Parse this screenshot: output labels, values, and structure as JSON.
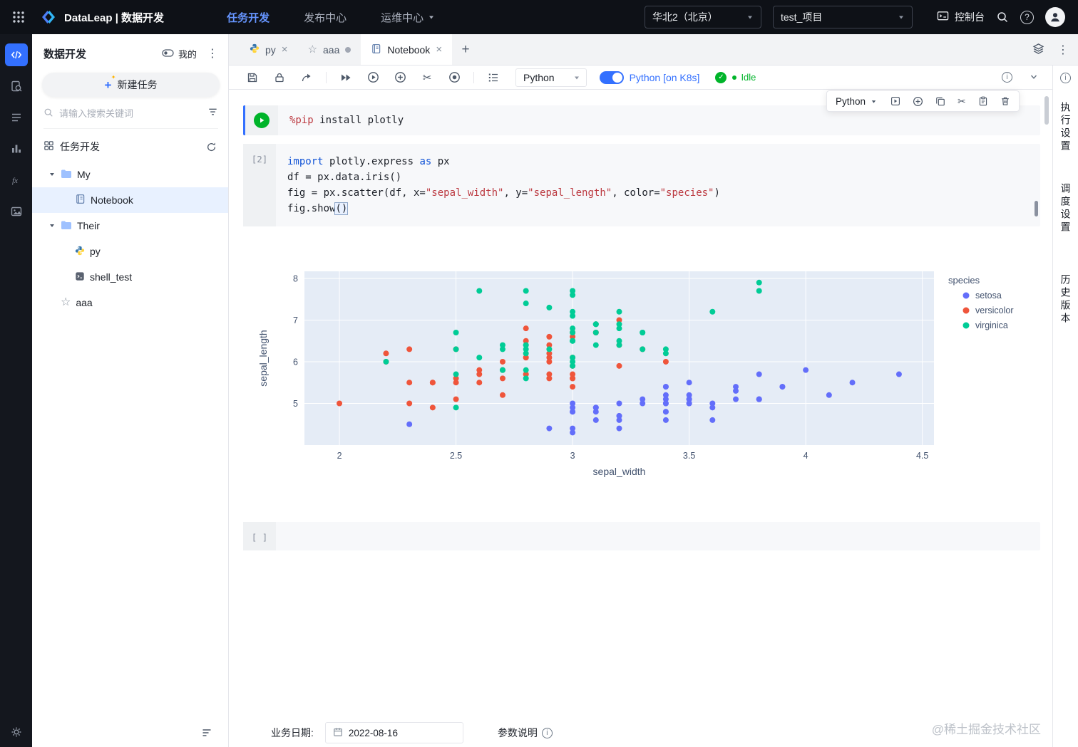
{
  "topbar": {
    "brand": "DataLeap | 数据开发",
    "nav_items": [
      {
        "label": "任务开发",
        "active": true
      },
      {
        "label": "发布中心",
        "active": false
      },
      {
        "label": "运维中心",
        "active": false
      }
    ],
    "region_select": "华北2（北京）",
    "project_select": "test_项目",
    "console_label": "控制台"
  },
  "sidebar": {
    "title": "数据开发",
    "mine_label": "我的",
    "new_task_label": "新建任务",
    "search_placeholder": "请输入搜索关键词",
    "section_label": "任务开发",
    "tree": {
      "folder_my": "My",
      "notebook": "Notebook",
      "folder_their": "Their",
      "py": "py",
      "shell": "shell_test",
      "aaa": "aaa"
    }
  },
  "tabs": {
    "py": "py",
    "aaa": "aaa",
    "notebook": "Notebook"
  },
  "toolbar": {
    "kernel": "Python",
    "k8s_label": "Python [on K8s]",
    "idle_label": "Idle"
  },
  "cell_toolbar": {
    "kernel": "Python"
  },
  "cells": {
    "c2_gutter": "[2]",
    "empty_gutter": "[ ]"
  },
  "code": {
    "cell1": [
      [
        [
          "magic",
          "%pip"
        ],
        [
          "plain",
          " install plotly"
        ]
      ]
    ],
    "cell2": [
      [
        [
          "kw",
          "import"
        ],
        [
          "plain",
          " plotly.express "
        ],
        [
          "kw",
          "as"
        ],
        [
          "plain",
          " px"
        ]
      ],
      [
        [
          "plain",
          "df = px.data.iris()"
        ]
      ],
      [
        [
          "plain",
          "fig = px.scatter(df, x="
        ],
        [
          "str",
          "\"sepal_width\""
        ],
        [
          "plain",
          ", y="
        ],
        [
          "str",
          "\"sepal_length\""
        ],
        [
          "plain",
          ", color="
        ],
        [
          "str",
          "\"species\""
        ],
        [
          "plain",
          ")"
        ]
      ],
      [
        [
          "plain",
          "fig.show"
        ],
        [
          "cursor",
          "()"
        ]
      ]
    ]
  },
  "right_rail": {
    "tabs": [
      "执行设置",
      "调度设置",
      "历史版本"
    ]
  },
  "bottombar": {
    "date_label": "业务日期:",
    "date_value": "2022-08-16",
    "params_label": "参数说明"
  },
  "watermark": "@稀土掘金技术社区",
  "chart_data": {
    "type": "scatter",
    "title": "",
    "xlabel": "sepal_width",
    "ylabel": "sepal_length",
    "xlim": [
      1.85,
      4.55
    ],
    "ylim": [
      4.0,
      8.17
    ],
    "xticks": [
      2,
      2.5,
      3,
      3.5,
      4,
      4.5
    ],
    "yticks": [
      5,
      6,
      7,
      8
    ],
    "grid": true,
    "plot_bg": "#e5ecf6",
    "legend_title": "species",
    "legend_position": "right",
    "series": [
      {
        "name": "setosa",
        "color": "#636efa",
        "x": [
          3.5,
          3.0,
          3.2,
          3.1,
          3.6,
          3.9,
          3.4,
          3.4,
          2.9,
          3.1,
          3.7,
          3.4,
          3.0,
          3.0,
          4.0,
          4.4,
          3.9,
          3.5,
          3.8,
          3.8,
          3.4,
          3.7,
          3.6,
          3.3,
          3.4,
          3.0,
          3.4,
          3.5,
          3.4,
          3.2,
          3.1,
          3.4,
          4.1,
          4.2,
          3.1,
          3.2,
          3.5,
          3.6,
          3.0,
          3.4,
          3.5,
          2.3,
          3.2,
          3.5,
          3.8,
          3.0,
          3.8,
          3.2,
          3.7,
          3.3
        ],
        "y": [
          5.1,
          4.9,
          4.7,
          4.6,
          5.0,
          5.4,
          4.6,
          5.0,
          4.4,
          4.9,
          5.4,
          4.8,
          4.8,
          4.3,
          5.8,
          5.7,
          5.4,
          5.1,
          5.7,
          5.1,
          5.4,
          5.1,
          4.6,
          5.1,
          4.8,
          5.0,
          5.0,
          5.2,
          5.2,
          4.7,
          4.8,
          5.4,
          5.2,
          5.5,
          4.9,
          5.0,
          5.5,
          4.9,
          4.4,
          5.1,
          5.0,
          4.5,
          4.4,
          5.0,
          5.1,
          4.8,
          5.1,
          4.6,
          5.3,
          5.0
        ]
      },
      {
        "name": "versicolor",
        "color": "#ef553b",
        "x": [
          3.2,
          3.2,
          3.1,
          2.3,
          2.8,
          2.8,
          3.3,
          2.4,
          2.9,
          2.7,
          2.0,
          3.0,
          2.2,
          2.9,
          2.9,
          3.1,
          3.0,
          2.7,
          2.2,
          2.5,
          3.2,
          2.8,
          2.5,
          2.8,
          2.9,
          3.0,
          2.8,
          3.0,
          2.9,
          2.6,
          2.4,
          2.4,
          2.7,
          2.7,
          3.0,
          3.4,
          3.1,
          2.3,
          3.0,
          2.5,
          2.6,
          3.0,
          2.6,
          2.3,
          2.7,
          3.0,
          2.9,
          2.9,
          2.5,
          2.8
        ],
        "y": [
          7.0,
          6.4,
          6.9,
          5.5,
          6.5,
          5.7,
          6.3,
          4.9,
          6.6,
          5.2,
          5.0,
          5.9,
          6.0,
          6.1,
          5.6,
          6.7,
          5.6,
          5.8,
          6.2,
          5.6,
          5.9,
          6.1,
          6.3,
          6.1,
          6.4,
          6.6,
          6.8,
          6.7,
          6.0,
          5.7,
          5.5,
          5.5,
          5.8,
          6.0,
          5.4,
          6.0,
          6.7,
          6.3,
          5.6,
          5.5,
          5.5,
          6.1,
          5.8,
          5.0,
          5.6,
          5.7,
          5.7,
          6.2,
          5.1,
          5.7
        ]
      },
      {
        "name": "virginica",
        "color": "#00cc96",
        "x": [
          3.3,
          2.7,
          3.0,
          2.9,
          3.0,
          3.0,
          2.5,
          2.9,
          2.5,
          3.6,
          3.2,
          2.7,
          3.0,
          2.5,
          2.8,
          3.2,
          3.0,
          3.8,
          2.6,
          2.2,
          3.2,
          2.8,
          2.8,
          2.7,
          3.3,
          3.2,
          2.8,
          3.0,
          2.8,
          3.0,
          2.8,
          3.8,
          2.8,
          2.8,
          2.6,
          3.0,
          3.4,
          3.1,
          3.0,
          3.1,
          3.1,
          3.1,
          2.7,
          3.2,
          3.3,
          3.0,
          2.5,
          3.0,
          3.4,
          3.0
        ],
        "y": [
          6.3,
          5.8,
          7.1,
          6.3,
          6.5,
          7.6,
          4.9,
          7.3,
          6.7,
          7.2,
          6.5,
          6.4,
          6.8,
          5.7,
          5.8,
          6.4,
          6.5,
          7.7,
          7.7,
          6.0,
          6.9,
          5.6,
          7.7,
          6.3,
          6.7,
          7.2,
          6.2,
          6.1,
          6.4,
          7.2,
          7.4,
          7.9,
          6.4,
          6.3,
          6.1,
          7.7,
          6.3,
          6.4,
          6.0,
          6.9,
          6.7,
          6.9,
          5.8,
          6.8,
          6.7,
          6.7,
          6.3,
          6.5,
          6.2,
          5.9
        ]
      }
    ]
  }
}
